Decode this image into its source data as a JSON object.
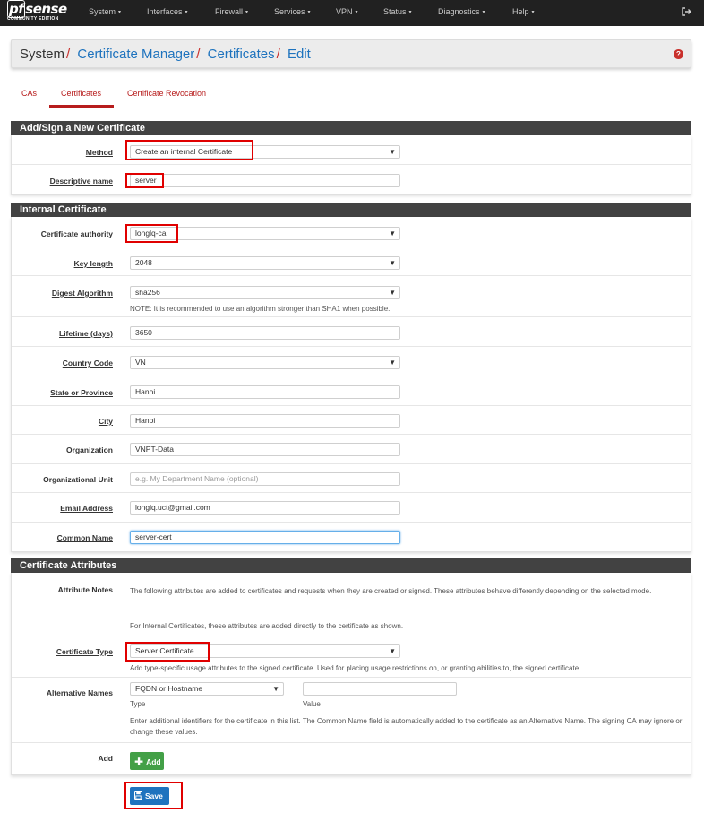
{
  "nav": {
    "brand": "sense",
    "brand_prefix": "pf",
    "edition": "COMMUNITY EDITION",
    "items": [
      "System",
      "Interfaces",
      "Firewall",
      "Services",
      "VPN",
      "Status",
      "Diagnostics",
      "Help"
    ],
    "caret": "▾",
    "logout_icon": "logout-icon"
  },
  "breadcrumb": {
    "root": "System",
    "separator": "/",
    "links": [
      "Certificate Manager",
      "Certificates",
      "Edit"
    ],
    "help_icon": "?"
  },
  "tabs": {
    "items": [
      "CAs",
      "Certificates",
      "Certificate Revocation"
    ],
    "active": "Certificates"
  },
  "sections": {
    "new_cert": {
      "title": "Add/Sign a New Certificate",
      "method_label": "Method",
      "method_value": "Create an internal Certificate",
      "descr_label": "Descriptive name",
      "descr_value": "server"
    },
    "internal": {
      "title": "Internal Certificate",
      "ca_label": "Certificate authority",
      "ca_value": "longlq-ca",
      "keylen_label": "Key length",
      "keylen_value": "2048",
      "digest_label": "Digest Algorithm",
      "digest_value": "sha256",
      "digest_note": "NOTE: It is recommended to use an algorithm stronger than SHA1 when possible.",
      "lifetime_label": "Lifetime (days)",
      "lifetime_value": "3650",
      "country_label": "Country Code",
      "country_value": "VN",
      "state_label": "State or Province",
      "state_value": "Hanoi",
      "city_label": "City",
      "city_value": "Hanoi",
      "org_label": "Organization",
      "org_value": "VNPT-Data",
      "orgunit_label": "Organizational Unit",
      "orgunit_placeholder": "e.g. My Department Name (optional)",
      "email_label": "Email Address",
      "email_value": "longlq.uct@gmail.com",
      "cn_label": "Common Name",
      "cn_value": "server-cert"
    },
    "attributes": {
      "title": "Certificate Attributes",
      "notes_label": "Attribute Notes",
      "notes_text1": "The following attributes are added to certificates and requests when they are created or signed. These attributes behave differently depending on the selected mode.",
      "notes_text2": "For Internal Certificates, these attributes are added directly to the certificate as shown.",
      "type_label": "Certificate Type",
      "type_value": "Server Certificate",
      "type_hint": "Add type-specific usage attributes to the signed certificate. Used for placing usage restrictions on, or granting abilities to, the signed certificate.",
      "alt_label": "Alternative Names",
      "alt_type_value": "FQDN or Hostname",
      "alt_value": "",
      "alt_type_caption": "Type",
      "alt_value_caption": "Value",
      "alt_hint": "Enter additional identifiers for the certificate in this list. The Common Name field is automatically added to the certificate as an Alternative Name. The signing CA may ignore or change these values.",
      "add_label": "Add",
      "add_button": "Add"
    }
  },
  "save_button": "Save",
  "colors": {
    "navbar": "#212121",
    "section_header": "#424242",
    "link": "#1e73be",
    "tab_active": "#b71c1c",
    "highlight": "#e00000",
    "add_button": "#43a047",
    "save_button": "#1e73be"
  }
}
